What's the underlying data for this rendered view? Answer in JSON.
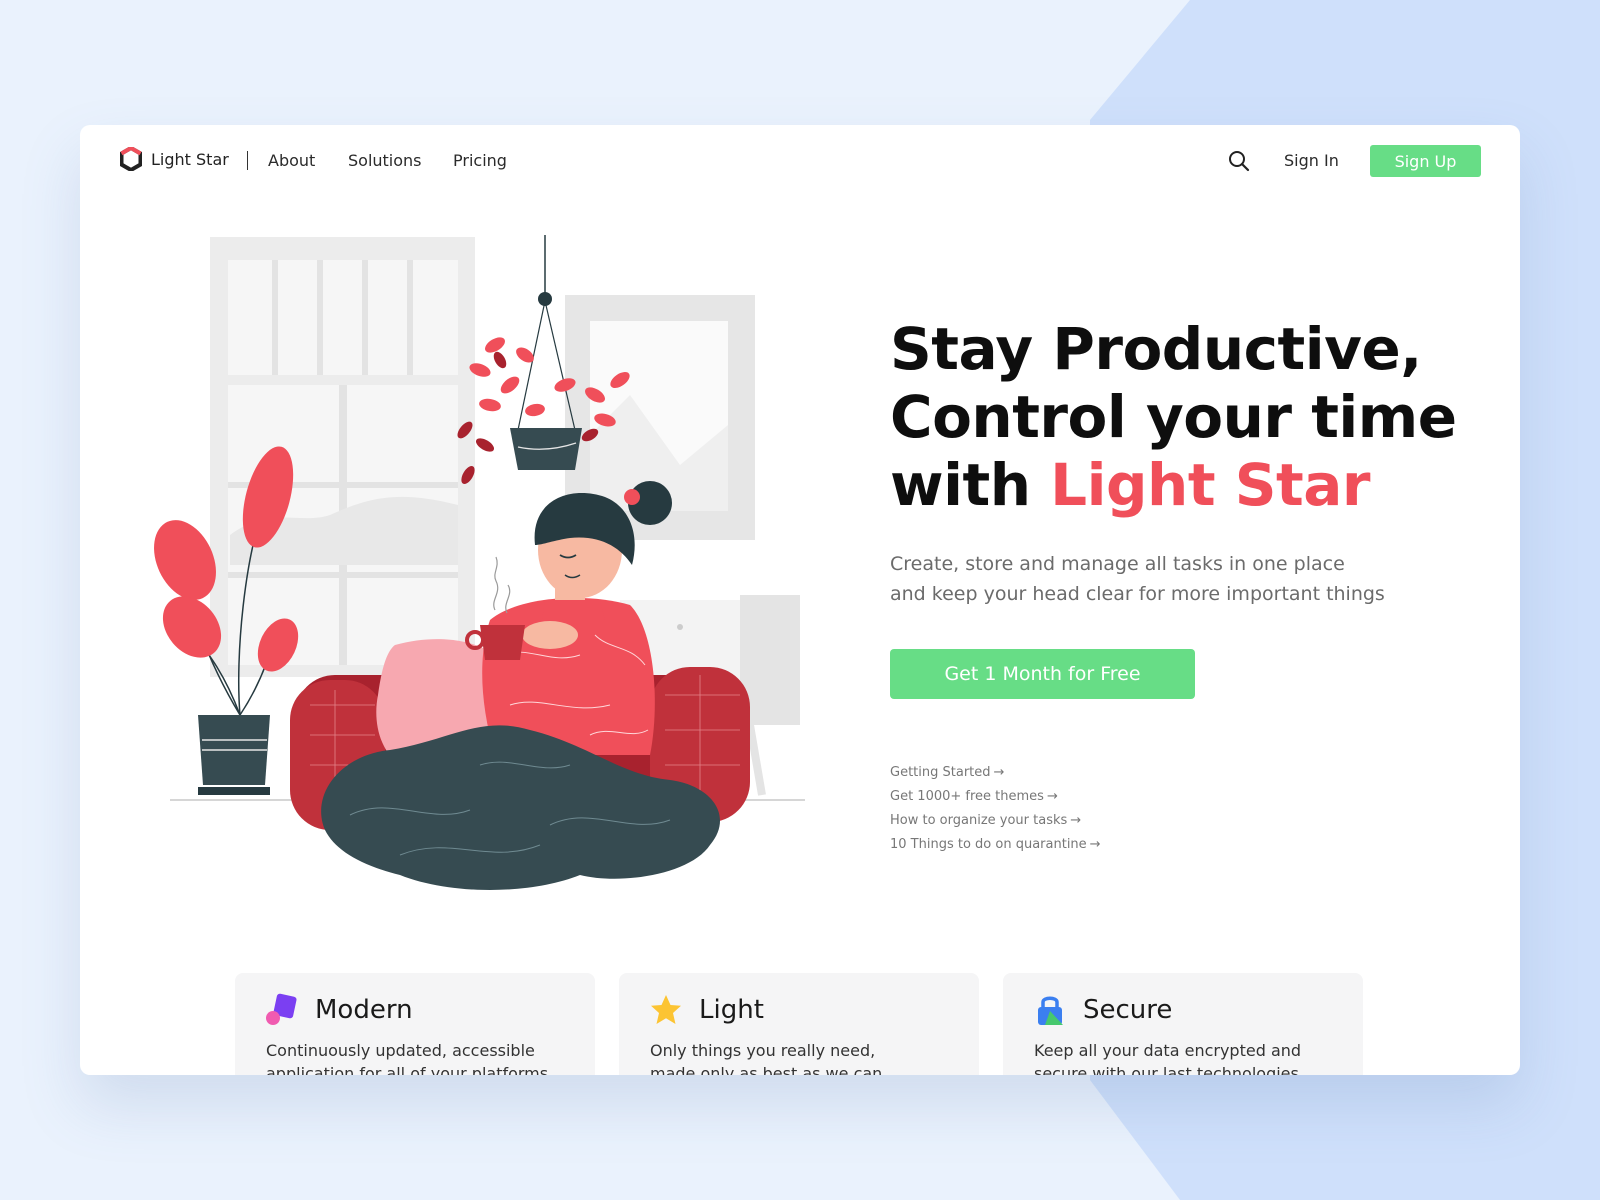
{
  "colors": {
    "background": "#eaf2fd",
    "background_shape": "#cfe0fb",
    "accent_green": "#67dd86",
    "accent_red": "#f04f5a",
    "text_dark": "#0e0e0e"
  },
  "nav": {
    "logo_icon": "hexagon-logo-icon",
    "logo_text": "Light Star",
    "links": [
      "About",
      "Solutions",
      "Pricing"
    ],
    "search_icon": "search-icon",
    "sign_in": "Sign In",
    "sign_up": "Sign Up"
  },
  "hero": {
    "title_line1": "Stay Productive,",
    "title_line2": "Control your time",
    "title_line3_prefix": "with ",
    "title_line3_accent": "Light Star",
    "subtitle_line1": "Create, store and manage all tasks in one place",
    "subtitle_line2": "and keep your head clear for more important things",
    "cta": "Get 1 Month for Free",
    "links": [
      "Getting Started",
      "Get 1000+ free themes",
      "How to organize your tasks",
      "10 Things to do on quarantine"
    ],
    "link_arrow": "→"
  },
  "features": [
    {
      "icon": "modern-shapes-icon",
      "title": "Modern",
      "desc_line1": "Continuously updated, accessible",
      "desc_line2": "application for all of your platforms"
    },
    {
      "icon": "star-icon",
      "title": "Light",
      "desc_line1": "Only things you really need,",
      "desc_line2": "made only as best as we can"
    },
    {
      "icon": "lock-icon",
      "title": "Secure",
      "desc_line1": "Keep all your data encrypted and",
      "desc_line2": "secure with our last technologies"
    }
  ]
}
